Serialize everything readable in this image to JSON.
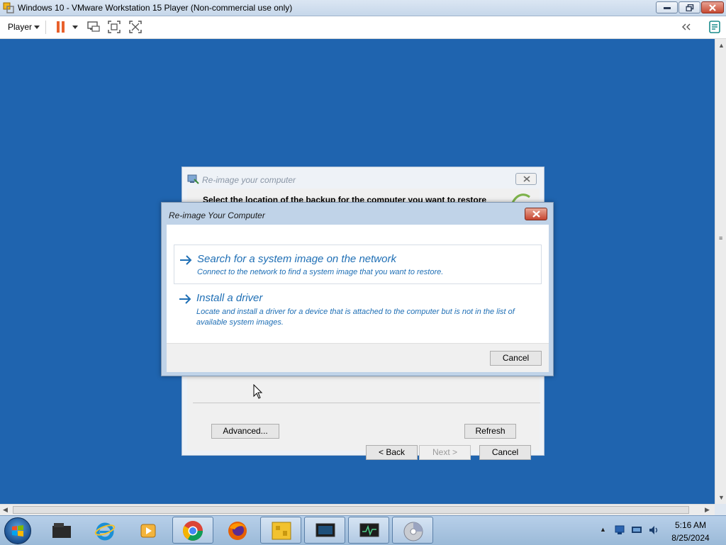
{
  "window": {
    "title": "Windows 10 - VMware Workstation 15 Player (Non-commercial use only)",
    "icons": [
      "vmware-app-icon",
      "minimize-icon",
      "restore-icon",
      "close-icon"
    ]
  },
  "toolbar": {
    "player_label": "Player",
    "pause_color": "#e8612c",
    "icons": [
      "pause-icon",
      "send-ctrl-alt-del-icon",
      "full-screen-icon",
      "unity-icon",
      "collapse-icon",
      "notes-icon"
    ]
  },
  "guest": {
    "background_color": "#1f64af"
  },
  "wizard": {
    "title": "Re-image your computer",
    "heading": "Select the location of the backup for the computer you want to restore",
    "advanced_label": "Advanced...",
    "refresh_label": "Refresh",
    "back_label": "< Back",
    "next_label": "Next >",
    "cancel_label": "Cancel"
  },
  "dialog": {
    "title": "Re-image Your Computer",
    "options": [
      {
        "title": "Search for a system image on the network",
        "description": "Connect to the network to find a system image that you want to restore."
      },
      {
        "title": "Install a driver",
        "description": "Locate and install a driver for a device that is attached to the computer but is not in the list of available system images."
      }
    ],
    "cancel_label": "Cancel",
    "accent_color": "#1f6fb5"
  },
  "taskbar": {
    "apps": [
      "start-orb",
      "file-explorer",
      "internet-explorer",
      "media-player",
      "chrome",
      "firefox",
      "app-yellow",
      "vm-window-1",
      "vm-window-2",
      "disc-app"
    ],
    "time": "5:16 AM",
    "date": "8/25/2024"
  }
}
